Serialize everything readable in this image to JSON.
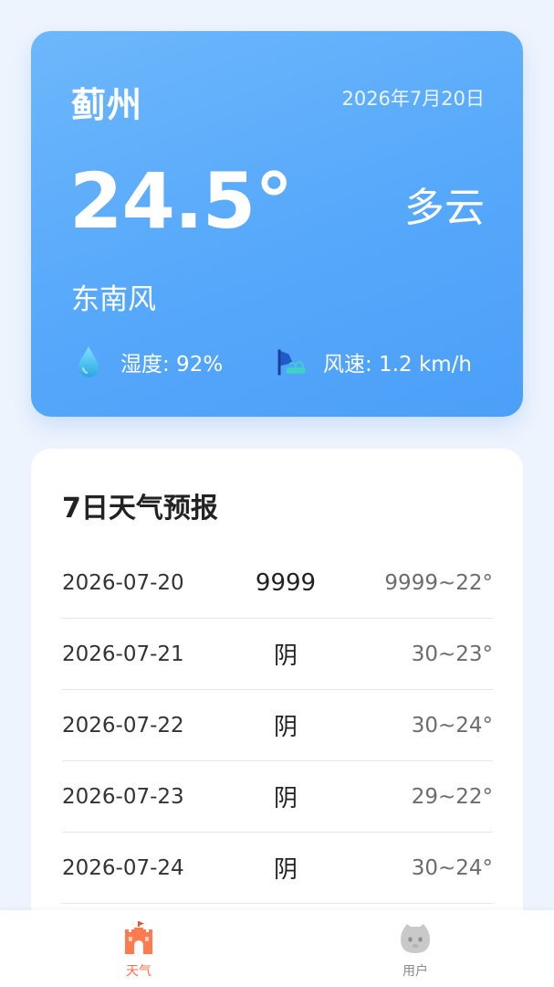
{
  "current": {
    "city": "蓟州",
    "date": "2026年7月20日",
    "temperature": "24.5°",
    "condition": "多云",
    "wind_direction": "东南风",
    "humidity_text": "湿度: 92%",
    "wind_speed_text": "风速: 1.2 km/h",
    "icons": {
      "humidity": "water-drop-icon",
      "wind": "wind-flag-icon"
    }
  },
  "forecast": {
    "title": "7日天气预报",
    "rows": [
      {
        "date": "2026-07-20",
        "condition": "9999",
        "temp": "9999~22°"
      },
      {
        "date": "2026-07-21",
        "condition": "阴",
        "temp": "30~23°"
      },
      {
        "date": "2026-07-22",
        "condition": "阴",
        "temp": "30~24°"
      },
      {
        "date": "2026-07-23",
        "condition": "阴",
        "temp": "29~22°"
      },
      {
        "date": "2026-07-24",
        "condition": "阴",
        "temp": "30~24°"
      }
    ]
  },
  "tabbar": {
    "tabs": [
      {
        "label": "天气",
        "icon": "castle-icon",
        "active": true
      },
      {
        "label": "用户",
        "icon": "user-face-icon",
        "active": false
      }
    ]
  },
  "colors": {
    "card_gradient_start": "#6db7fb",
    "card_gradient_end": "#4c9ff8",
    "active_tab": "#ff6b42",
    "inactive_tab": "#8a8a8a",
    "page_background": "#eef4fd"
  }
}
